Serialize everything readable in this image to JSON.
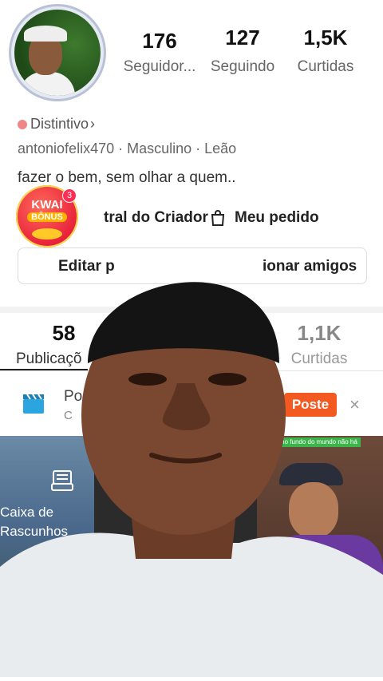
{
  "profile": {
    "stats": [
      {
        "value": "176",
        "label": "Seguidor..."
      },
      {
        "value": "127",
        "label": "Seguindo"
      },
      {
        "value": "1,5K",
        "label": "Curtidas"
      }
    ],
    "badge_label": "Distintivo",
    "badge_chevron": "›",
    "meta_line": "antoniofelix470 · Masculino · Leão",
    "bio": "fazer o bem, sem olhar a quem.."
  },
  "promo": {
    "title": "KWAI",
    "subtitle": "BÔNUS",
    "count": "3"
  },
  "actions": {
    "creator_center": "tral do Criador",
    "my_order": "Meu pedido",
    "edit_profile": "Editar p",
    "add_friends": "ionar amigos"
  },
  "tabs": [
    {
      "value": "58",
      "label": "Publicaçõ"
    },
    {
      "value": "1,1K",
      "label": "Curtidas"
    }
  ],
  "banner": {
    "title": "Po",
    "subtitle": "C",
    "button": "Poste",
    "close": "×"
  },
  "grid": {
    "drafts_label_line1": "Caixa de",
    "drafts_label_line2": "Rascunhos",
    "right_caption": "no fundo do mundo não há"
  },
  "colors": {
    "accent": "#f25a22",
    "active_tab_underline": "#222222",
    "muted_text": "#666666"
  }
}
